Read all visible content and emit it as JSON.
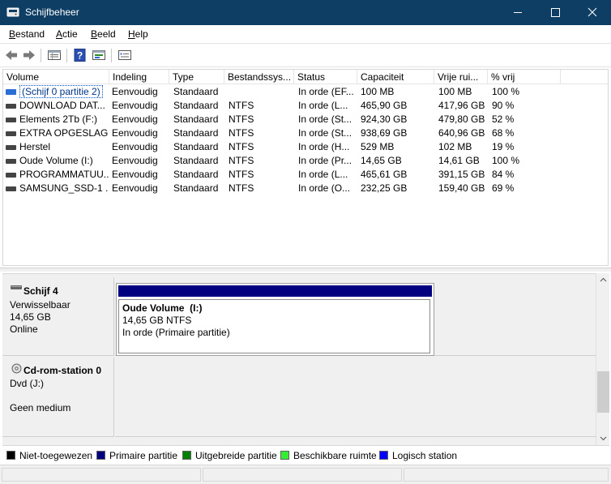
{
  "window": {
    "title": "Schijfbeheer"
  },
  "menu": [
    "Bestand",
    "Actie",
    "Beeld",
    "Help"
  ],
  "toolbar_icons": [
    "back-icon",
    "forward-icon",
    "details-view-icon",
    "help-icon",
    "graphical-view-icon",
    "properties-icon"
  ],
  "table": {
    "columns": [
      "Volume",
      "Indeling",
      "Type",
      "Bestandssys...",
      "Status",
      "Capaciteit",
      "Vrije rui...",
      "% vrij"
    ],
    "rows": [
      {
        "volume": "(Schijf 0 partitie 2)",
        "indeling": "Eenvoudig",
        "type": "Standaard",
        "fs": "",
        "status": "In orde (EF...",
        "capaciteit": "100 MB",
        "vrij": "100 MB",
        "pct": "100 %"
      },
      {
        "volume": "DOWNLOAD DAT...",
        "indeling": "Eenvoudig",
        "type": "Standaard",
        "fs": "NTFS",
        "status": "In orde (L...",
        "capaciteit": "465,90 GB",
        "vrij": "417,96 GB",
        "pct": "90 %"
      },
      {
        "volume": "Elements 2Tb (F:)",
        "indeling": "Eenvoudig",
        "type": "Standaard",
        "fs": "NTFS",
        "status": "In orde (St...",
        "capaciteit": "924,30 GB",
        "vrij": "479,80 GB",
        "pct": "52 %"
      },
      {
        "volume": "EXTRA OPGESLAG...",
        "indeling": "Eenvoudig",
        "type": "Standaard",
        "fs": "NTFS",
        "status": "In orde (St...",
        "capaciteit": "938,69 GB",
        "vrij": "640,96 GB",
        "pct": "68 %"
      },
      {
        "volume": "Herstel",
        "indeling": "Eenvoudig",
        "type": "Standaard",
        "fs": "NTFS",
        "status": "In orde (H...",
        "capaciteit": "529 MB",
        "vrij": "102 MB",
        "pct": "19 %"
      },
      {
        "volume": "Oude Volume (I:)",
        "indeling": "Eenvoudig",
        "type": "Standaard",
        "fs": "NTFS",
        "status": "In orde (Pr...",
        "capaciteit": "14,65 GB",
        "vrij": "14,61 GB",
        "pct": "100 %"
      },
      {
        "volume": "PROGRAMMATUU...",
        "indeling": "Eenvoudig",
        "type": "Standaard",
        "fs": "NTFS",
        "status": "In orde (L...",
        "capaciteit": "465,61 GB",
        "vrij": "391,15 GB",
        "pct": "84 %"
      },
      {
        "volume": "SAMSUNG_SSD-1 ...",
        "indeling": "Eenvoudig",
        "type": "Standaard",
        "fs": "NTFS",
        "status": "In orde (O...",
        "capaciteit": "232,25 GB",
        "vrij": "159,40 GB",
        "pct": "69 %"
      }
    ]
  },
  "disks": [
    {
      "name": "Schijf 4",
      "type": "Verwisselbaar",
      "size": "14,65 GB",
      "state": "Online",
      "partition": {
        "label": "Oude Volume  (I:)",
        "size": "14,65 GB NTFS",
        "status": "In orde (Primaire partitie)"
      }
    },
    {
      "name": "Cd-rom-station 0",
      "type": "Dvd (J:)",
      "state": "Geen medium"
    }
  ],
  "legend": [
    {
      "label": "Niet-toegewezen",
      "color": "#000000"
    },
    {
      "label": "Primaire partitie",
      "color": "#000080"
    },
    {
      "label": "Uitgebreide partitie",
      "color": "#008000"
    },
    {
      "label": "Beschikbare ruimte",
      "color": "#33ee33"
    },
    {
      "label": "Logisch station",
      "color": "#0000ff"
    }
  ],
  "colors": {
    "titlebar": "#0e3e63",
    "primary_partition_bar": "#000080"
  }
}
